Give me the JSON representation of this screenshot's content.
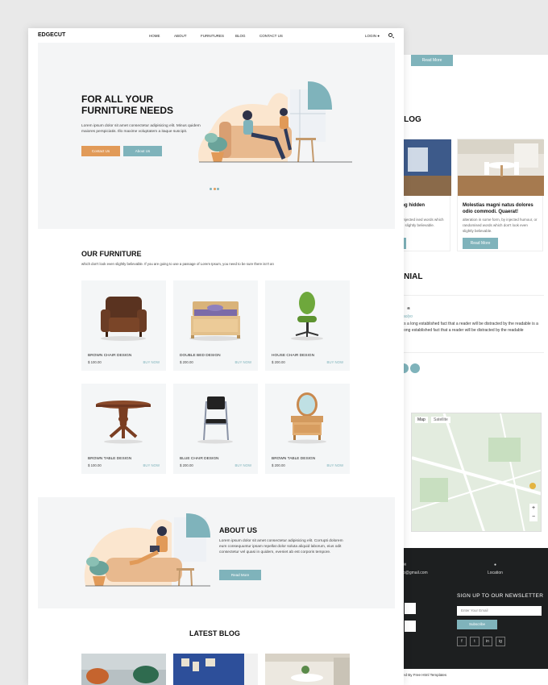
{
  "nav": {
    "logo": "EDGECUT",
    "items": [
      "HOME",
      "ABOUT",
      "FURNITURES",
      "BLOG",
      "CONTACT US"
    ],
    "login": "LOGIN"
  },
  "hero": {
    "title": "FOR ALL YOUR FURNITURE NEEDS",
    "text": "Lorem ipsum dolor sit amet consectetur adipisicing elit. Minus quidem maiores perspiciatis. Illo maxime voluptatem a itaque suscipit.",
    "btn_contact": "Contact Us",
    "btn_about": "About Us"
  },
  "furniture": {
    "title": "OUR FURNITURE",
    "subtitle": "which don't look even slightly believable. If you are going to use a passage of Lorem Ipsum, you need to be sure there isn't an",
    "buy_label": "BUY NOW",
    "products": [
      {
        "name": "BROWN CHAIR DESIGN",
        "price": "$ 100.00",
        "icon": "armchair-icon"
      },
      {
        "name": "DOUBLE BED DESIGN",
        "price": "$ 200.00",
        "icon": "bed-icon"
      },
      {
        "name": "HOUSE CHAIR DESIGN",
        "price": "$ 200.00",
        "icon": "office-chair-icon"
      },
      {
        "name": "BROWN TABLE DESIGN",
        "price": "$ 100.00",
        "icon": "table-icon"
      },
      {
        "name": "BLUE CHAIR DESIGN",
        "price": "$ 200.00",
        "icon": "chair-icon"
      },
      {
        "name": "BROWN TABLE DESIGN",
        "price": "$ 200.00",
        "icon": "dressing-table-icon"
      }
    ]
  },
  "about": {
    "title": "ABOUT US",
    "text": "Lorem ipsum dolor sit amet consectetur adipisicing elit. Corrupti dolorem eum consequuntur ipsam repellat dolor soluta aliquid laborum, eius odit consectetur vel quasi in quidem, eveniet ab est corporis tempore.",
    "btn": "Read More"
  },
  "latest_blog": {
    "title": "LATEST BLOG"
  },
  "back": {
    "read_more": "Read More",
    "blog_title": "T BLOG",
    "card1_title": "rrassing hidden",
    "card1_text": "form, by injected ised words which look even slightly believable.",
    "card2_title": "Molestias magni natus dolores odio commodi. Quaerat!",
    "card2_text": "alteration in some form, by injected humour, or randomised words which don't look even slightly believable.",
    "card2_btn": "Read More",
    "testimonial_title": "MONIAL",
    "quote": "“",
    "testi_name": "aolyo",
    "testi_text": "is a long established fact that a reader will be distracted by the readable is a long established fact that a reader will be distracted by the readable",
    "map_tab1": "Map",
    "map_tab2": "Satellite",
    "email": "o@gmail.com",
    "location": "Location",
    "newsletter_title": "SIGN UP TO OUR NEWSLETTER",
    "newsletter_placeholder": "Enter Your Email",
    "subscribe": "Subscribe",
    "social": [
      "f",
      "t",
      "in",
      "ig"
    ],
    "copyright": "ed By Free Html Templates",
    "colors": {
      "teal": "#7fb3bb",
      "orange": "#e19a58",
      "dark": "#1d1f20"
    }
  }
}
